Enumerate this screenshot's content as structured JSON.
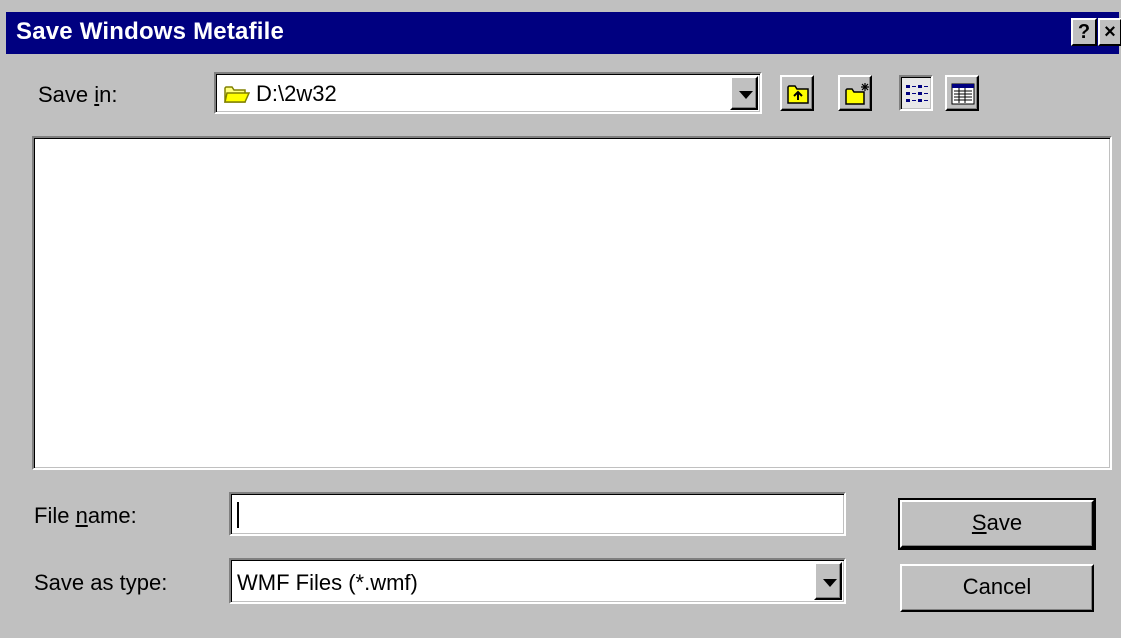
{
  "window": {
    "title": "Save Windows Metafile",
    "help_label": "?",
    "close_label": "×"
  },
  "save_in": {
    "label_prefix": "Save ",
    "label_mnemonic": "i",
    "label_suffix": "n:",
    "value": "D:\\2w32"
  },
  "toolbar": {
    "up_one_level": "up-folder-icon",
    "create_new_folder": "new-folder-icon",
    "list_view": "list-view-icon",
    "details_view": "details-view-icon"
  },
  "file_name": {
    "label_prefix": "File ",
    "label_mnemonic": "n",
    "label_suffix": "ame:",
    "value": ""
  },
  "save_as_type": {
    "label": "Save as type:",
    "selected": "WMF Files (*.wmf)"
  },
  "buttons": {
    "save_mnemonic": "S",
    "save_rest": "ave",
    "cancel": "Cancel"
  },
  "colors": {
    "title_bar": "#000080",
    "face": "#c0c0c0"
  }
}
